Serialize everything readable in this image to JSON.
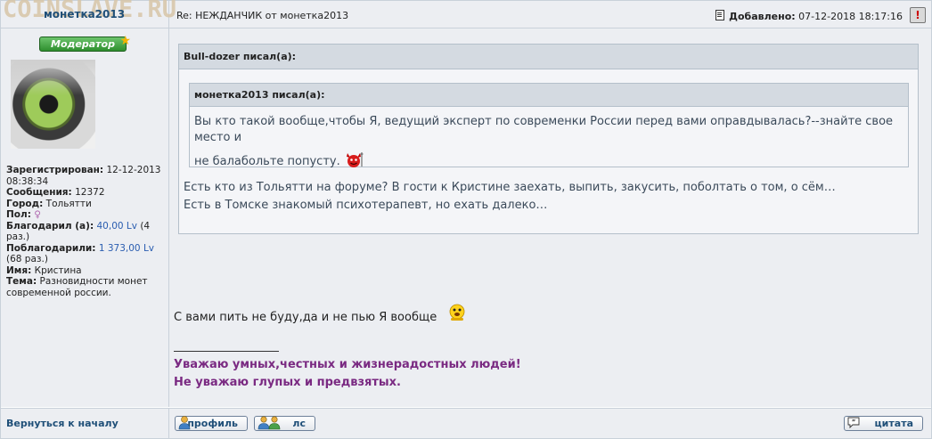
{
  "header": {
    "watermark": "COINSLAVE.RU",
    "author": "монетка2013",
    "subject": "Re: НЕЖДАНЧИК от монетка2013",
    "added_label": "Добавлено:",
    "added_date": "07-12-2018 18:17:16",
    "report_symbol": "!"
  },
  "profile": {
    "badge": "Модератор",
    "registered_label": "Зарегистрирован:",
    "registered_value": "12-12-2013 08:38:34",
    "posts_label": "Сообщения:",
    "posts_value": "12372",
    "city_label": "Город:",
    "city_value": "Тольятти",
    "gender_label": "Пол:",
    "gender_symbol": "♀",
    "thanked_label": "Благодарил (а):",
    "thanked_value": "40,00 Lv",
    "thanked_times": "(4 раз.)",
    "got_thanks_label": "Поблагодарили:",
    "got_thanks_value": "1 373,00 Lv",
    "got_thanks_times": "(68 раз.)",
    "name_label": "Имя:",
    "name_value": "Кристина",
    "topic_label": "Тема:",
    "topic_value": "Разновидности монет современной россии.",
    "back_to_top": "Вернуться к началу"
  },
  "post": {
    "outer_quote_author": "Bull-dozer писал(а):",
    "inner_quote_author": "монетка2013 писал(а):",
    "inner_quote_line1": "Вы кто такой вообще,чтобы Я, ведущий эксперт по современки России перед вами оправдывалась?--знайте свое место и",
    "inner_quote_line2": "не балабольте попусту.",
    "outer_quote_line1": "Есть кто из Тольятти на форуме? В гости к Кристине заехать, выпить, закусить, поболтать о том, о сём…",
    "outer_quote_line2": "Есть в Томске знакомый психотерапевт, но ехать далеко…",
    "text": "С вами пить не буду,да и не пью Я вообще",
    "signature_line1": "Уважаю умных,честных и жизнерадостных людей!",
    "signature_line2": "Не уважаю глупых и предвзятых."
  },
  "buttons": {
    "profile": "профиль",
    "pm": "лс",
    "quote": "цитата"
  },
  "colors": {
    "panel_bg": "#eceef2",
    "quote_head": "#d4dae1",
    "signature": "#7a2a82",
    "link": "#1f4f78"
  }
}
